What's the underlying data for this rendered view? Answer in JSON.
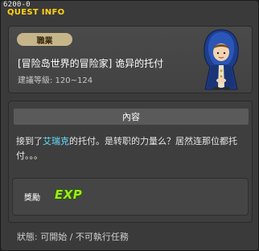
{
  "quest_id": "6200-0",
  "window_title": "QUEST INFO",
  "header": {
    "category": "職業",
    "title": "[冒险岛世界的冒险家] 诡异的托付",
    "recommended_level": "建議等級: 120~124"
  },
  "content": {
    "section_title": "內容",
    "description_before": "接到了",
    "npc_name": "艾瑞克",
    "description_after": "的托付。是转职的力量么？居然连那位都托付。。。",
    "reward_label": "獎勵",
    "reward_icon": "exp-icon",
    "reward_text": "EXP"
  },
  "status": "狀態: 可開始 / 不可執行任務",
  "colors": {
    "title_yellow": "#ffd21f",
    "npc_name_cyan": "#66e0ff",
    "exp_green": "#9bea1f"
  }
}
